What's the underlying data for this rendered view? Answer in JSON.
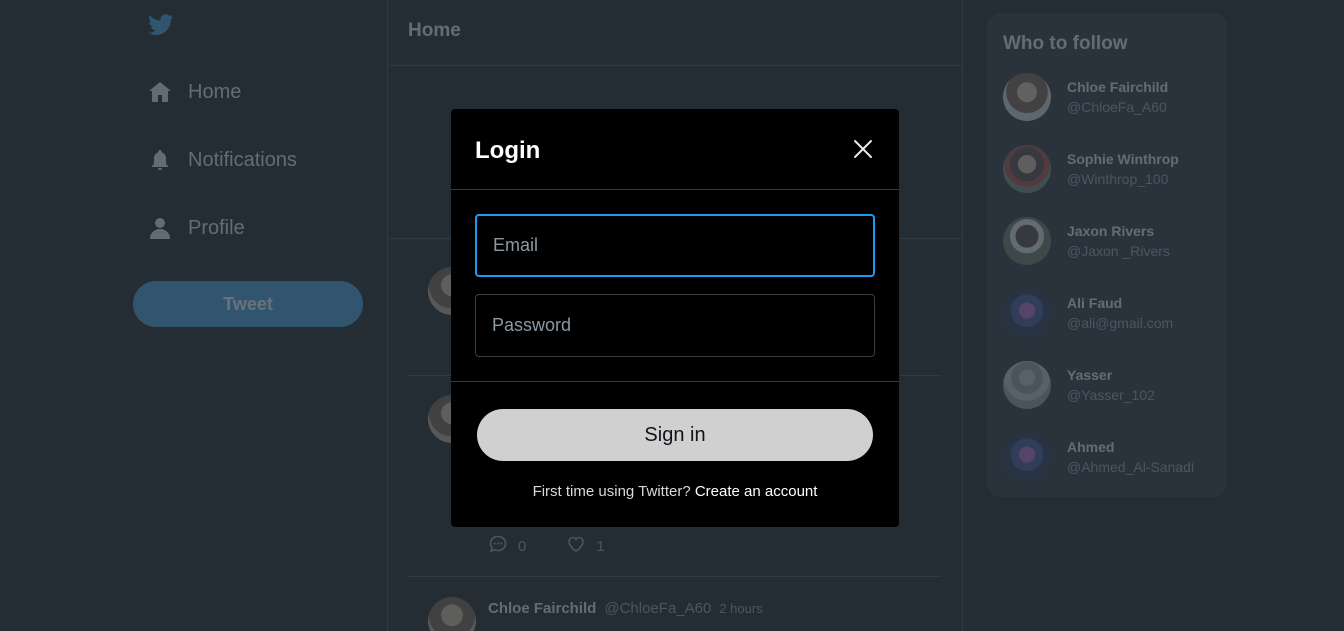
{
  "sidebar": {
    "logo_icon": "twitter-bird-icon",
    "items": [
      {
        "label": "Home",
        "icon": "home-icon"
      },
      {
        "label": "Notifications",
        "icon": "bell-icon"
      },
      {
        "label": "Profile",
        "icon": "user-icon"
      }
    ],
    "tweet_button": "Tweet"
  },
  "main": {
    "header_title": "Home",
    "tweet_actions": {
      "replies": "0",
      "likes": "1"
    },
    "last_tweet": {
      "name": "Chloe Fairchild",
      "handle": "@ChloeFa_A60",
      "time": "2 hours"
    }
  },
  "who_to_follow": {
    "title": "Who to follow",
    "users": [
      {
        "name": "Chloe Fairchild",
        "handle": "@ChloeFa_A60"
      },
      {
        "name": "Sophie Winthrop",
        "handle": "@Winthrop_100"
      },
      {
        "name": "Jaxon Rivers",
        "handle": "@Jaxon _Rivers"
      },
      {
        "name": "Ali Faud",
        "handle": "@ali@gmail.com"
      },
      {
        "name": "Yasser",
        "handle": "@Yasser_102"
      },
      {
        "name": "Ahmed",
        "handle": "@Ahmed_Al-Sanadi"
      }
    ]
  },
  "login_modal": {
    "title": "Login",
    "email_placeholder": "Email",
    "password_placeholder": "Password",
    "signin_button": "Sign in",
    "signup_prompt": "First time using Twitter?",
    "signup_link": "Create an account"
  },
  "colors": {
    "accent": "#1d9bf0",
    "background": "#000000",
    "signin_button": "#d0d0d0"
  }
}
